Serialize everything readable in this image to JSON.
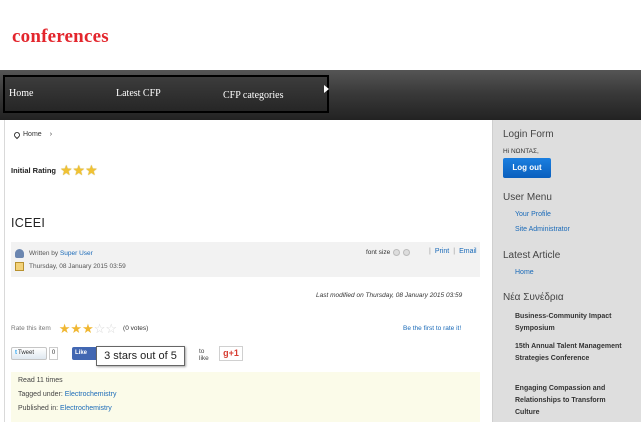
{
  "site": {
    "logo": "conferences"
  },
  "nav": {
    "items": [
      "Home",
      "Latest CFP",
      "CFP categories"
    ]
  },
  "breadcrumb": {
    "home": "Home",
    "separator": "›"
  },
  "initial_rating": {
    "label": "Initial Rating",
    "stars": "★★★"
  },
  "article": {
    "title": "ICEEI",
    "written_by_label": "Written by",
    "author": "Super User",
    "date": "Thursday, 08 January 2015 03:59",
    "font_size_label": "font size",
    "print": "Print",
    "email": "Email",
    "last_modified": "Last modified on Thursday, 08 January 2015 03:59"
  },
  "rating": {
    "label": "Rate this item",
    "value": 3,
    "max": 5,
    "votes": "(0 votes)",
    "first_link": "Be the first to rate it!",
    "tooltip": "3 stars out of 5"
  },
  "share": {
    "tweet": "Tweet",
    "tweet_count": "0",
    "fb_like": "Like",
    "to_like": "to like",
    "gplus": "g+1"
  },
  "meta": {
    "read": "Read 11 times",
    "tagged_label": "Tagged under:",
    "tag": "Electrochemistry",
    "published_label": "Published in:",
    "category": "Electrochemistry"
  },
  "sidebar": {
    "login_heading": "Login Form",
    "greeting": "Hi ΝΩΝΤΑΣ,",
    "logout": "Log out",
    "user_menu_heading": "User Menu",
    "user_menu": [
      "Your Profile",
      "Site Administrator"
    ],
    "latest_heading": "Latest Article",
    "latest": [
      "Home"
    ],
    "news_heading": "Νέα Συνέδρια",
    "news": [
      "Business-Community Impact Symposium",
      "15th Annual Talent Management Strategies Conference",
      "Engaging Compassion and Relationships to Transform Culture"
    ]
  },
  "colors": {
    "logo": "#e3262d",
    "link": "#1a6ab8",
    "button": "#0a6ad0",
    "star": "#f1c232"
  }
}
